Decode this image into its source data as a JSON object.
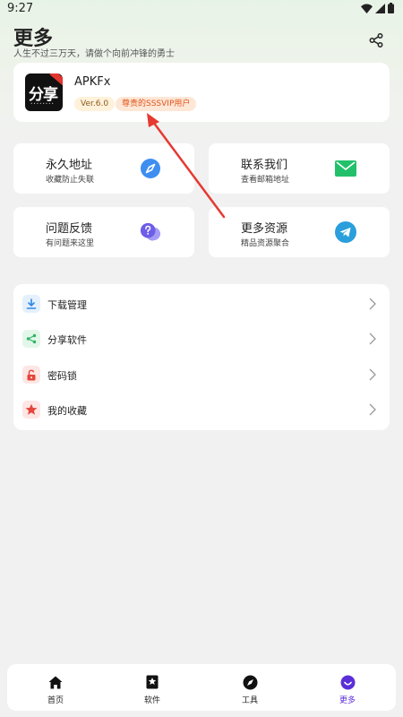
{
  "status_bar": {
    "time": "9:27"
  },
  "header": {
    "title": "更多",
    "subtitle": "人生不过三万天，请做个向前冲锋的勇士"
  },
  "profile": {
    "logo_text": "分享",
    "app_name": "APKFx",
    "version": "Ver.6.0",
    "vip_label": "尊贵的SSSVIP用户"
  },
  "tiles": [
    {
      "title": "永久地址",
      "subtitle": "收藏防止失联",
      "icon": "compass-icon",
      "color": "#3e8ef0"
    },
    {
      "title": "联系我们",
      "subtitle": "查看邮箱地址",
      "icon": "mail-icon",
      "color": "#22c06a"
    },
    {
      "title": "问题反馈",
      "subtitle": "有问题来这里",
      "icon": "question-chat-icon",
      "color": "#7b6cf0"
    },
    {
      "title": "更多资源",
      "subtitle": "精品资源聚合",
      "icon": "telegram-icon",
      "color": "#2a9fdc"
    }
  ],
  "menu": [
    {
      "label": "下载管理",
      "icon": "download-icon",
      "color": "#2f88e6",
      "bg": "#e4f0fc"
    },
    {
      "label": "分享软件",
      "icon": "share-icon",
      "color": "#2eb566",
      "bg": "#e3f6ea"
    },
    {
      "label": "密码锁",
      "icon": "lock-icon",
      "color": "#e5443a",
      "bg": "#fde6e4"
    },
    {
      "label": "我的收藏",
      "icon": "star-icon",
      "color": "#e5443a",
      "bg": "#fde6e4"
    }
  ],
  "nav": [
    {
      "label": "首页",
      "icon": "home-icon",
      "active": false
    },
    {
      "label": "软件",
      "icon": "bookmark-star-icon",
      "active": false
    },
    {
      "label": "工具",
      "icon": "compass-icon",
      "active": false
    },
    {
      "label": "更多",
      "icon": "smile-icon",
      "active": true
    }
  ],
  "colors": {
    "accent": "#5b2fd8",
    "arrow": "#e53a32",
    "vip_text": "#e2541c"
  }
}
